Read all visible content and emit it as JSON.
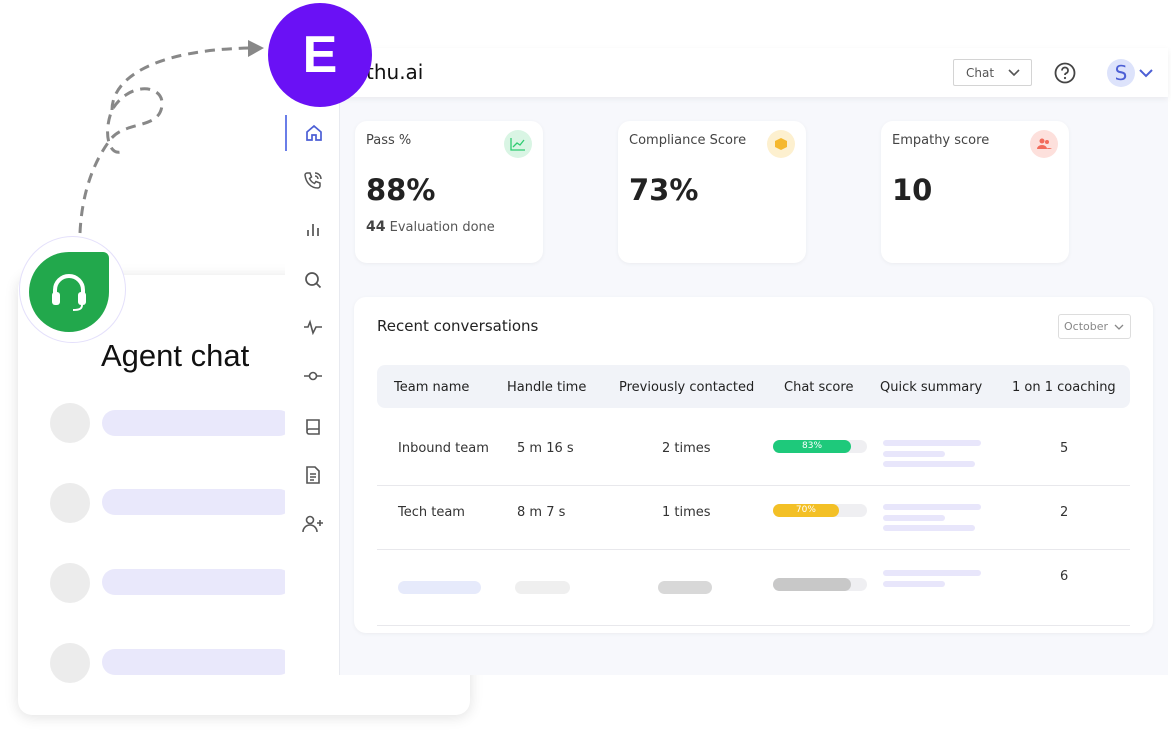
{
  "agent_card": {
    "title": "Agent chat"
  },
  "app": {
    "brand": "thu.ai",
    "logo_letter": "E",
    "channel_select": "Chat",
    "user_initial": "S"
  },
  "sidebar": {
    "items": [
      "home",
      "calls",
      "analytics",
      "search",
      "activity",
      "commit",
      "book",
      "document",
      "add-user"
    ]
  },
  "cards": [
    {
      "label": "Pass %",
      "value": "88%",
      "sub_count": "44",
      "sub_text": "Evaluation done",
      "icon": "chart-line-icon",
      "color": "#2ecc71"
    },
    {
      "label": "Compliance Score",
      "value": "73%",
      "icon": "box-icon",
      "color": "#f5b82e"
    },
    {
      "label": "Empathy score",
      "value": "10",
      "icon": "users-icon",
      "color": "#f26b5b"
    }
  ],
  "recent": {
    "title": "Recent conversations",
    "month_select": "October",
    "columns": [
      "Team name",
      "Handle time",
      "Previously contacted",
      "Chat score",
      "Quick summary",
      "1 on 1 coaching"
    ],
    "rows": [
      {
        "team": "Inbound team",
        "handle": "5 m 16 s",
        "contacted": "2 times",
        "score": "83%",
        "score_value": 83,
        "score_color": "#1ec97b",
        "coaching": "5"
      },
      {
        "team": "Tech team",
        "handle": "8 m 7 s",
        "contacted": "1 times",
        "score": "70%",
        "score_value": 70,
        "score_color": "#f3c026",
        "coaching": "2"
      },
      {
        "team": "",
        "handle": "",
        "contacted": "",
        "score": "",
        "score_value": 83,
        "score_color": "#c8c8c8",
        "coaching": "6"
      }
    ]
  },
  "colors": {
    "logo": "#6a11f5",
    "agent": "#22a84c",
    "accent": "#4c5fd5"
  }
}
